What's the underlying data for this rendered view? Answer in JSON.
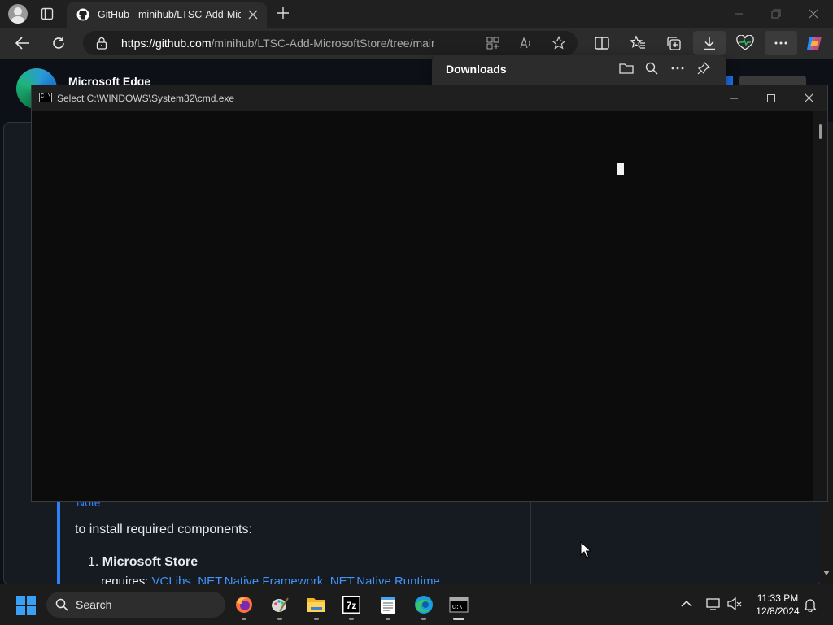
{
  "browser": {
    "tab_title": "GitHub - minihub/LTSC-Add-Microsoft",
    "url_domain": "https://github.com",
    "url_path": "/minihub/LTSC-Add-MicrosoftStore/tree/main?ta...",
    "toolbar_icons": [
      "split-screen-icon",
      "favorites-icon",
      "collections-icon",
      "download-icon",
      "browser-essentials-icon",
      "more-icon",
      "copilot-icon"
    ]
  },
  "page": {
    "app_name": "Microsoft Edge",
    "note_label": "Note",
    "note_text": "to install required components:",
    "list_number": "1.",
    "list_item": "Microsoft Store",
    "requires_label": "requires:",
    "requires_links": [
      "VCLibs",
      "NET.Native.Framework",
      "NET.Native.Runtime"
    ],
    "accent": "#2f81f7"
  },
  "downloads": {
    "title": "Downloads"
  },
  "cmd": {
    "title": "Select C:\\WINDOWS\\System32\\cmd.exe",
    "icon_text": "C:\\"
  },
  "taskbar": {
    "search_label": "Search",
    "pinned_apps": [
      "firefox",
      "paint",
      "file-explorer",
      "7zip",
      "notepad",
      "edge",
      "terminal"
    ],
    "time": "11:33 PM",
    "date": "12/8/2024"
  }
}
